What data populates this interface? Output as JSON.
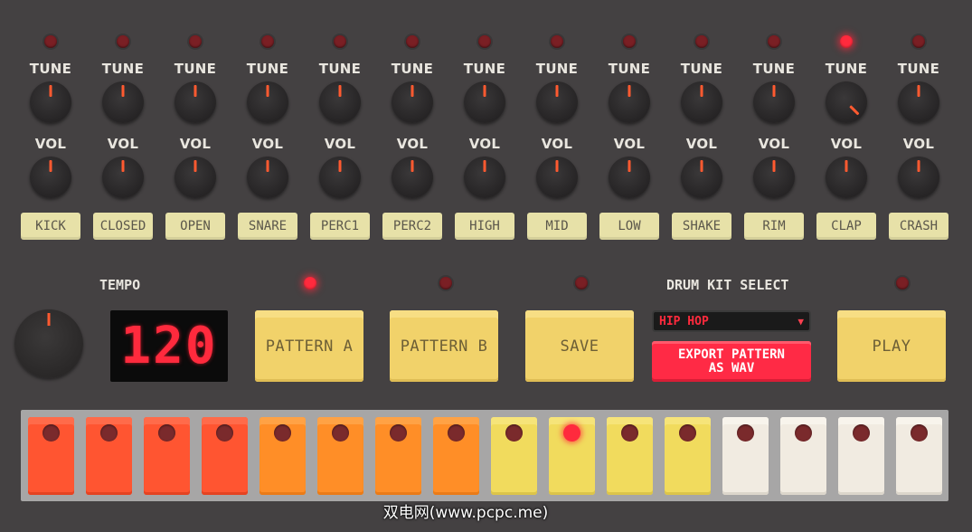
{
  "channels": [
    {
      "name": "KICK",
      "tune_label": "TUNE",
      "vol_label": "VOL",
      "led_on": false,
      "tune": 0,
      "vol": 0
    },
    {
      "name": "CLOSED",
      "tune_label": "TUNE",
      "vol_label": "VOL",
      "led_on": false,
      "tune": 0,
      "vol": 0
    },
    {
      "name": "OPEN",
      "tune_label": "TUNE",
      "vol_label": "VOL",
      "led_on": false,
      "tune": 0,
      "vol": 0
    },
    {
      "name": "SNARE",
      "tune_label": "TUNE",
      "vol_label": "VOL",
      "led_on": false,
      "tune": 0,
      "vol": 0
    },
    {
      "name": "PERC1",
      "tune_label": "TUNE",
      "vol_label": "VOL",
      "led_on": false,
      "tune": 0,
      "vol": 0
    },
    {
      "name": "PERC2",
      "tune_label": "TUNE",
      "vol_label": "VOL",
      "led_on": false,
      "tune": 0,
      "vol": 0
    },
    {
      "name": "HIGH",
      "tune_label": "TUNE",
      "vol_label": "VOL",
      "led_on": false,
      "tune": 0,
      "vol": 0
    },
    {
      "name": "MID",
      "tune_label": "TUNE",
      "vol_label": "VOL",
      "led_on": false,
      "tune": 0,
      "vol": 0
    },
    {
      "name": "LOW",
      "tune_label": "TUNE",
      "vol_label": "VOL",
      "led_on": false,
      "tune": 0,
      "vol": 0
    },
    {
      "name": "SHAKE",
      "tune_label": "TUNE",
      "vol_label": "VOL",
      "led_on": false,
      "tune": 0,
      "vol": 0
    },
    {
      "name": "RIM",
      "tune_label": "TUNE",
      "vol_label": "VOL",
      "led_on": false,
      "tune": 0,
      "vol": 0
    },
    {
      "name": "CLAP",
      "tune_label": "TUNE",
      "vol_label": "VOL",
      "led_on": true,
      "tune": 0.9,
      "vol": 0
    },
    {
      "name": "CRASH",
      "tune_label": "TUNE",
      "vol_label": "VOL",
      "led_on": false,
      "tune": 0,
      "vol": 0
    }
  ],
  "tempo": {
    "label": "TEMPO",
    "value": "120",
    "knob_level": 0
  },
  "pattern_a": {
    "label": "PATTERN A",
    "led_on": true
  },
  "pattern_b": {
    "label": "PATTERN B",
    "led_on": false
  },
  "save": {
    "label": "SAVE",
    "led_on": false
  },
  "play": {
    "label": "PLAY",
    "led_on": false
  },
  "kit": {
    "label": "DRUM KIT SELECT",
    "selected": "HIP HOP",
    "chevron_icon": "chevron-down-icon"
  },
  "export": {
    "label": "EXPORT PATTERN\nAS WAV"
  },
  "steps": [
    {
      "color": "red",
      "active": false
    },
    {
      "color": "red",
      "active": false
    },
    {
      "color": "red",
      "active": false
    },
    {
      "color": "red",
      "active": false
    },
    {
      "color": "orange",
      "active": false
    },
    {
      "color": "orange",
      "active": false
    },
    {
      "color": "orange",
      "active": false
    },
    {
      "color": "orange",
      "active": false
    },
    {
      "color": "yellow",
      "active": false
    },
    {
      "color": "yellow",
      "active": true
    },
    {
      "color": "yellow",
      "active": false
    },
    {
      "color": "yellow",
      "active": false
    },
    {
      "color": "white",
      "active": false
    },
    {
      "color": "white",
      "active": false
    },
    {
      "color": "white",
      "active": false
    },
    {
      "color": "white",
      "active": false
    }
  ],
  "colors": {
    "background": "#444142",
    "led_on": "#ff2a3d",
    "led_off": "#7a1f24",
    "button_yellow": "#f1d26a",
    "export_red": "#ff2a45"
  },
  "watermark": "双电网(www.pcpc.me)"
}
